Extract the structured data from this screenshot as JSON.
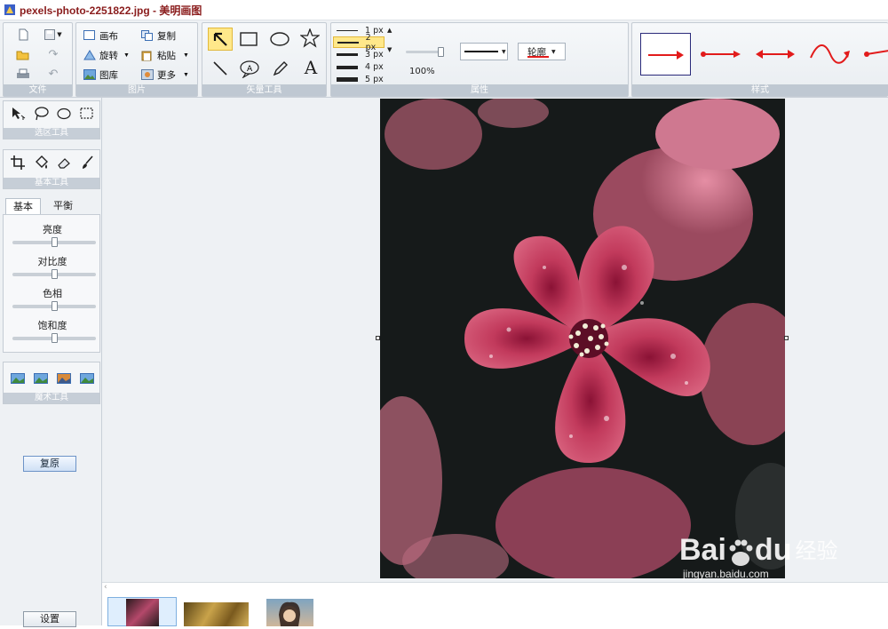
{
  "window": {
    "title": "pexels-photo-2251822.jpg - 美明画图"
  },
  "ribbon": {
    "file": {
      "label": "文件"
    },
    "picture": {
      "label": "图片",
      "canvas": "画布",
      "copy": "复制",
      "rotate": "旋转",
      "paste": "粘贴",
      "gallery": "图库",
      "more": "更多"
    },
    "vector_tools": {
      "label": "矢量工具",
      "text_tool": "A"
    },
    "properties": {
      "label": "属性",
      "line_widths": [
        "1 px",
        "2 px",
        "3 px",
        "4 px",
        "5 px"
      ],
      "selected_width": "2 px",
      "zoom": "100%",
      "outline": "轮廓"
    },
    "styles": {
      "label": "样式"
    }
  },
  "left_panel": {
    "selection_tools_label": "选区工具",
    "basic_tools_label": "基本工具",
    "tabs": [
      "基本",
      "平衡"
    ],
    "adjustments": [
      "亮度",
      "对比度",
      "色相",
      "饱和度"
    ],
    "adjustment_levels": [
      0.5,
      0.5,
      0.5,
      0.5
    ],
    "magic_tools_label": "魔术工具",
    "restore_button": "复原",
    "settings_button": "设置"
  },
  "watermark": {
    "brand": "Bai",
    "brand2": "du",
    "cn": "经验",
    "url": "jingyan.baidu.com"
  },
  "colors": {
    "accent_red": "#e21b1b",
    "title_red": "#8a1c1c",
    "selected_tool": "#ffe88a"
  }
}
